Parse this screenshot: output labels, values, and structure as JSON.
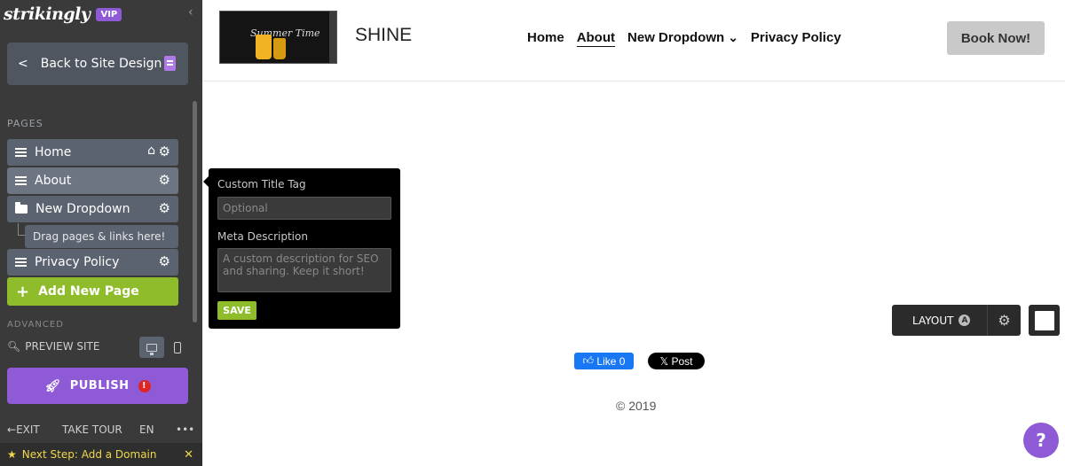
{
  "sidebar": {
    "logo": "strikingly",
    "badge": "VIP",
    "back_label": "Back to Site Design",
    "pages_label": "PAGES",
    "pages": [
      {
        "label": "Home"
      },
      {
        "label": "About"
      },
      {
        "label": "New Dropdown"
      },
      {
        "label": "Privacy Policy"
      }
    ],
    "drag_hint": "Drag pages & links here!",
    "add_page": "Add New Page",
    "advanced": "ADVANCED",
    "preview": "PREVIEW SITE",
    "publish": "PUBLISH",
    "publish_alert": "!",
    "exit": "EXIT",
    "tour": "TAKE TOUR",
    "lang": "EN",
    "more": "•••",
    "next_step": "Next Step: Add a Domain",
    "close": "✕"
  },
  "header": {
    "thumb_text": "Summer Time",
    "brand": "SHINE",
    "nav": [
      "Home",
      "About",
      "New Dropdown",
      "Privacy Policy"
    ],
    "book": "Book Now!"
  },
  "seo": {
    "title_label": "Custom Title Tag",
    "title_placeholder": "Optional",
    "desc_label": "Meta Description",
    "desc_placeholder": "A custom description for SEO and sharing. Keep it short!",
    "save": "SAVE"
  },
  "layout_widget": {
    "label": "LAYOUT",
    "badge": "A"
  },
  "footer": {
    "fb": "Like 0",
    "x_post": "Post",
    "copyright": "© 2019"
  },
  "help": "?",
  "colors": {
    "accent_purple": "#8e5ad6",
    "accent_green": "#8fbc2b",
    "sidebar_bg": "#3a3a3a"
  }
}
